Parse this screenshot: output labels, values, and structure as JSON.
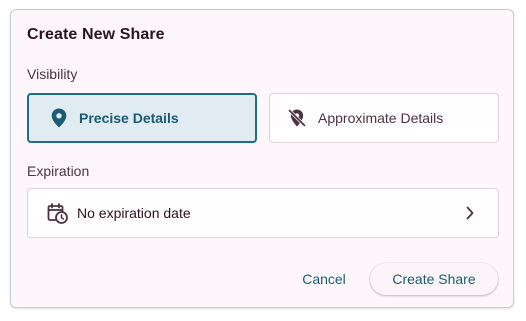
{
  "dialog": {
    "title": "Create New Share",
    "visibility_label": "Visibility",
    "options": [
      {
        "label": "Precise Details",
        "icon": "location-pin-icon",
        "selected": true
      },
      {
        "label": "Approximate Details",
        "icon": "location-off-icon",
        "selected": false
      }
    ],
    "expiration_label": "Expiration",
    "expiration_value": "No expiration date",
    "cancel_label": "Cancel",
    "create_label": "Create Share"
  },
  "colors": {
    "accent": "#1a5c74",
    "selected_border": "#1c6f86",
    "selected_bg": "#e1ebf2",
    "dialog_bg": "#fdf7fb",
    "dialog_border": "#b9d3d3"
  }
}
